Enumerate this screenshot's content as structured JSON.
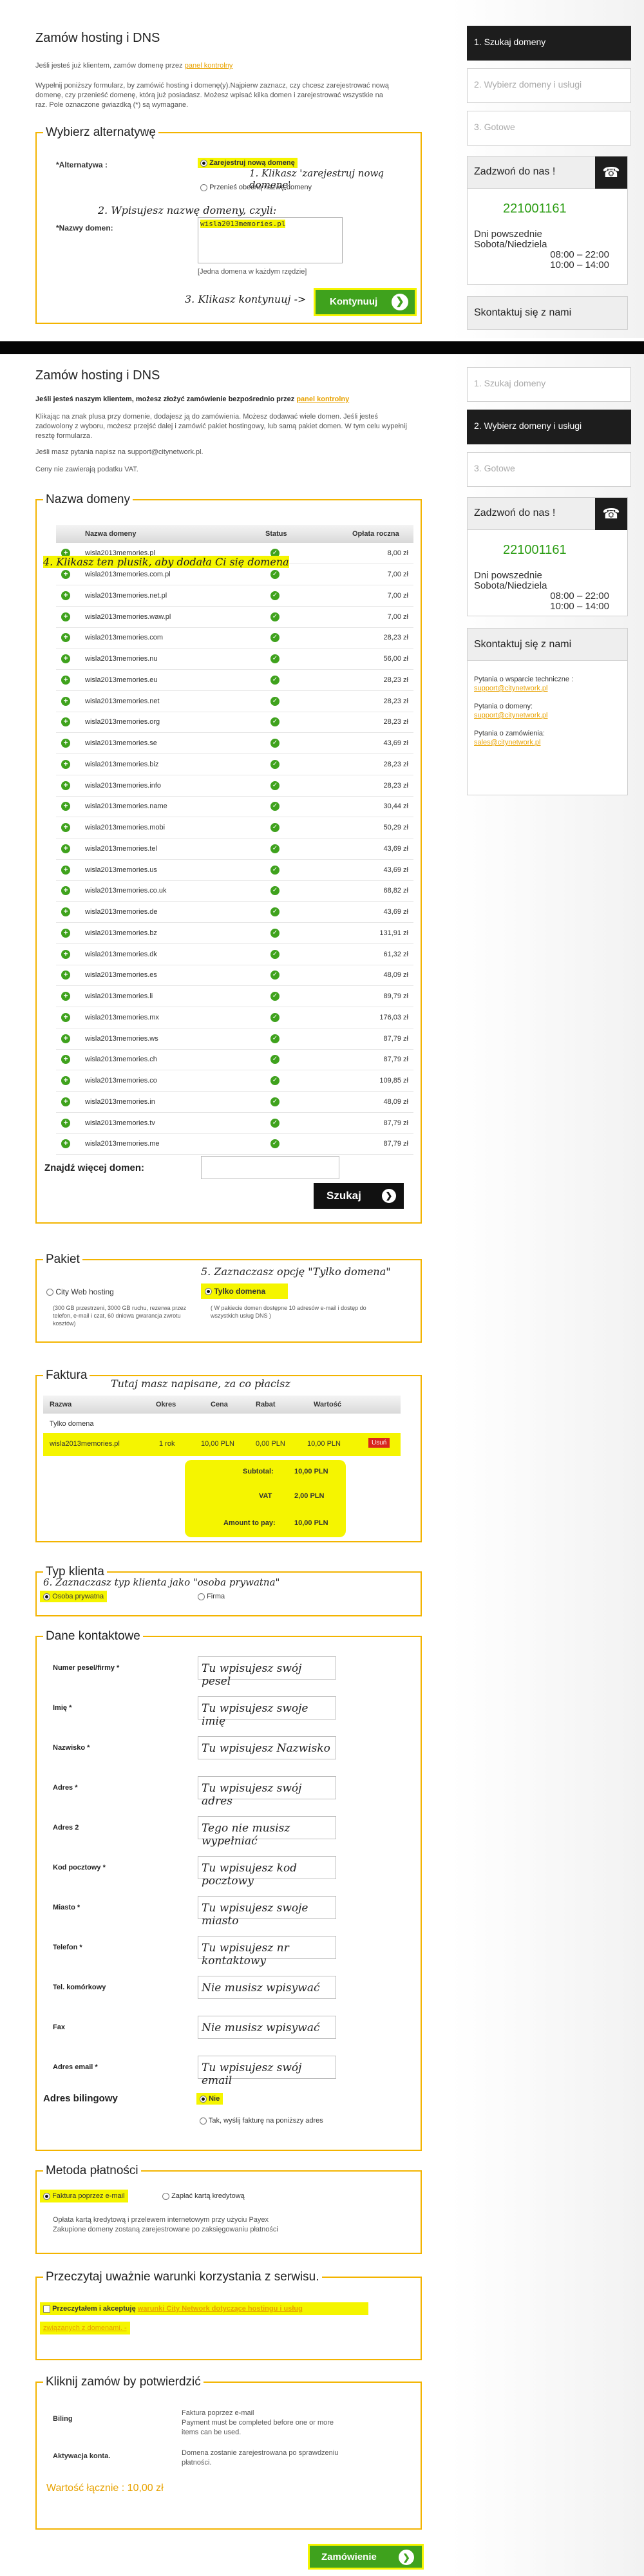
{
  "shot1": {
    "title": "Zamów hosting i DNS",
    "logged_in_text": "Jeśli jesteś już klientem, zamów domenę przez",
    "panel_link": "panel kontrolny",
    "intro": "Wypełnij poniższy formularz, by zamówić hosting i domenę(y).Najpierw zaznacz, czy chcesz zarejestrować nową domenę, czy przenieść domenę, którą już posiadasz. Możesz wpisać kilka domen i zarejestrować wszystkie na raz. Pole oznaczone gwiazdką (*) są wymagane.",
    "section_title": "Wybierz alternatywę",
    "alt_label": "*Alternatywa :",
    "opt_new": "Zarejestruj nową domenę",
    "opt_transfer": "Przenieś obecną nazwę domeny",
    "domain_label": "*Nazwy domen:",
    "domain_value": "wisla2013memories.pl",
    "domain_hint": "[Jedna domena w każdym rzędzie]",
    "continue_label": "Kontynuuj",
    "ann1": "1. Klikasz 'zarejestruj nową domenę'",
    "ann2": "2. Wpisujesz nazwę domeny, czyli:",
    "ann3": "3. Klikasz kontynuuj ->"
  },
  "sidebar": {
    "steps": [
      "1. Szukaj domeny",
      "2. Wybierz domeny i usługi",
      "3. Gotowe"
    ],
    "call_title": "Zadzwoń do nas !",
    "phone_icon": "phone-icon",
    "phone": "221001161",
    "days": "Dni powszednie",
    "weekend": "Sobota/Niedziela",
    "hours_week": "08:00 – 22:00",
    "hours_weekend": "10:00 – 14:00",
    "contact_title": "Skontaktuj się z nami",
    "tech_label": "Pytania o wsparcie techniczne :",
    "tech_mail": "support@citynetwork.pl",
    "dom_label": "Pytania o domeny:",
    "dom_mail": "support@citynetwork.pl",
    "order_label": "Pytania o zamówienia:",
    "order_mail": "sales@citynetwork.pl"
  },
  "shot2": {
    "title": "Zamów hosting i DNS",
    "bold_line": "Jeśli jesteś naszym klientem, możesz złożyć zamówienie bezpośrednio przez",
    "panel_link": "panel kontrolny",
    "p1": "Klikając na znak plusa przy domenie, dodajesz ją do zamówienia. Możesz dodawać wiele domen. Jeśli jesteś zadowolony z wyboru, możesz przejść dalej i zamówić pakiet hostingowy, lub samą pakiet domen. W tym celu wypełnij resztę formularza.",
    "p2": "Jeśli masz pytania napisz na support@citynetwork.pl.",
    "p3": "Ceny nie zawierają podatku VAT.",
    "domains_title": "Nazwa domeny",
    "col_domain": "Nazwa domeny",
    "col_status": "Status",
    "col_price": "Opłata roczna",
    "ann4": "4. Klikasz ten plusik, aby dodała Ci się domena",
    "domains": [
      {
        "name": "wisla2013memories.pl",
        "price": "8,00 zł"
      },
      {
        "name": "wisla2013memories.com.pl",
        "price": "7,00 zł"
      },
      {
        "name": "wisla2013memories.net.pl",
        "price": "7,00 zł"
      },
      {
        "name": "wisla2013memories.waw.pl",
        "price": "7,00 zł"
      },
      {
        "name": "wisla2013memories.com",
        "price": "28,23 zł"
      },
      {
        "name": "wisla2013memories.nu",
        "price": "56,00 zł"
      },
      {
        "name": "wisla2013memories.eu",
        "price": "28,23 zł"
      },
      {
        "name": "wisla2013memories.net",
        "price": "28,23 zł"
      },
      {
        "name": "wisla2013memories.org",
        "price": "28,23 zł"
      },
      {
        "name": "wisla2013memories.se",
        "price": "43,69 zł"
      },
      {
        "name": "wisla2013memories.biz",
        "price": "28,23 zł"
      },
      {
        "name": "wisla2013memories.info",
        "price": "28,23 zł"
      },
      {
        "name": "wisla2013memories.name",
        "price": "30,44 zł"
      },
      {
        "name": "wisla2013memories.mobi",
        "price": "50,29 zł"
      },
      {
        "name": "wisla2013memories.tel",
        "price": "43,69 zł"
      },
      {
        "name": "wisla2013memories.us",
        "price": "43,69 zł"
      },
      {
        "name": "wisla2013memories.co.uk",
        "price": "68,82 zł"
      },
      {
        "name": "wisla2013memories.de",
        "price": "43,69 zł"
      },
      {
        "name": "wisla2013memories.bz",
        "price": "131,91 zł"
      },
      {
        "name": "wisla2013memories.dk",
        "price": "61,32 zł"
      },
      {
        "name": "wisla2013memories.es",
        "price": "48,09 zł"
      },
      {
        "name": "wisla2013memories.li",
        "price": "89,79 zł"
      },
      {
        "name": "wisla2013memories.mx",
        "price": "176,03 zł"
      },
      {
        "name": "wisla2013memories.ws",
        "price": "87,79 zł"
      },
      {
        "name": "wisla2013memories.ch",
        "price": "87,79 zł"
      },
      {
        "name": "wisla2013memories.co",
        "price": "109,85 zł"
      },
      {
        "name": "wisla2013memories.in",
        "price": "48,09 zł"
      },
      {
        "name": "wisla2013memories.tv",
        "price": "87,79 zł"
      },
      {
        "name": "wisla2013memories.me",
        "price": "87,79 zł"
      }
    ],
    "find_more": "Znajdź więcej domen:",
    "search_btn": "Szukaj",
    "pkg_title": "Pakiet",
    "ann5": "5. Zaznaczasz opcję \"Tylko domena\"",
    "pkg_city": "City Web hosting",
    "pkg_city_desc": "(300 GB przestrzeni, 3000 GB ruchu, rezerwa przez telefon, e-mail i czat, 60 dniowa gwarancja zwrotu kosztów)",
    "pkg_domain": "Tylko domena",
    "pkg_domain_desc": "( W pakiecie domen dostępne 10 adresów e-mail i dostęp do wszystkich usług DNS )",
    "inv_title": "Faktura",
    "ann_inv": "Tutaj masz napisane, za co płacisz",
    "inv_cols": [
      "Razwa",
      "Okres",
      "Cena",
      "Rabat",
      "Wartość"
    ],
    "inv_row1": "Tylko domena",
    "inv_row2": {
      "name": "wisla2013memories.pl",
      "period": "1 rok",
      "price": "10,00 PLN",
      "discount": "0,00 PLN",
      "value": "10,00 PLN",
      "del": "Usuń"
    },
    "subtotal_label": "Subtotal:",
    "subtotal": "10,00 PLN",
    "vat_label": "VAT",
    "vat": "2,00 PLN",
    "total_label": "Amount to pay:",
    "total": "10,00 PLN",
    "ctype_title": "Typ klienta",
    "ann6": "6. Zaznaczasz typ klienta jako \"osoba prywatna\"",
    "ctype_private": "Osoba prywatna",
    "ctype_firm": "Firma",
    "contact_title": "Dane kontaktowe",
    "fields": [
      {
        "label": "Numer pesel/firmy *",
        "value": "Tu wpisujesz swój pesel"
      },
      {
        "label": "Imię *",
        "value": "Tu wpisujesz swoje imię"
      },
      {
        "label": "Nazwisko *",
        "value": "Tu wpisujesz Nazwisko"
      },
      {
        "label": "Adres *",
        "value": "Tu wpisujesz swój adres"
      },
      {
        "label": "Adres 2",
        "value": "Tego nie musisz wypełniać"
      },
      {
        "label": "Kod pocztowy *",
        "value": "Tu wpisujesz kod pocztowy"
      },
      {
        "label": "Miasto *",
        "value": "Tu wpisujesz swoje miasto"
      },
      {
        "label": "Telefon *",
        "value": "Tu wpisujesz nr kontaktowy"
      },
      {
        "label": "Tel. komórkowy",
        "value": "Nie musisz wpisywać"
      },
      {
        "label": "Fax",
        "value": "Nie musisz wpisywać"
      },
      {
        "label": "Adres email *",
        "value": "Tu wpisujesz swój email"
      }
    ],
    "billing_title": "Adres bilingowy",
    "billing_no": "Nie",
    "billing_yes": "Tak, wyślij fakturę na poniższy adres",
    "pay_title": "Metoda płatności",
    "pay_email": "Faktura poprzez e-mail",
    "pay_card": "Zapłać kartą kredytową",
    "pay_note": "Opłata kartą kredytową i przelewem internetowym przy użyciu Payex\nZakupione domeny zostaną zarejestrowane po zaksięgowaniu płatności",
    "terms_title": "Przeczytaj uważnie warunki korzystania z serwisu.",
    "terms_text": "Przeczytałem i akceptuję",
    "terms_link": "warunki City Network dotyczące hostingu i usług",
    "terms_link2": "związanych z domenami. -",
    "confirm_title": "Kliknij zamów by potwierdzić",
    "billing_label": "Biling",
    "billing_info": "Faktura poprzez e-mail\nPayment must be completed before one or more items can be used.",
    "activation_label": "Aktywacja konta.",
    "activation_info": "Domena zostanie zarejestrowana po sprawdzeniu płatności.",
    "total_line": "Wartość łącznie : 10,00 zł",
    "order_btn": "Zamówienie"
  }
}
